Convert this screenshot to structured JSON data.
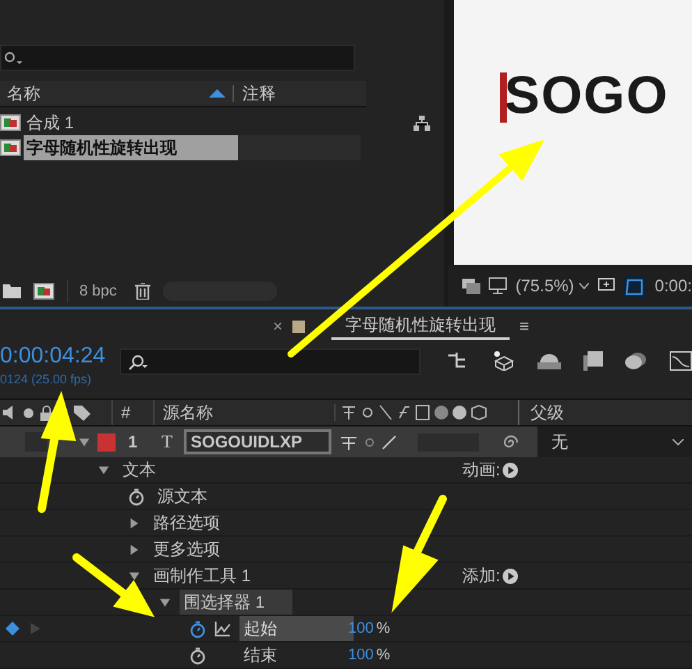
{
  "project_panel": {
    "columns": [
      "名称",
      "注释"
    ],
    "items": [
      {
        "name": "合成 1",
        "selected": false
      },
      {
        "name": "字母随机性旋转出现",
        "selected": true
      }
    ],
    "footer": {
      "bpc": "8 bpc"
    }
  },
  "viewer": {
    "preview_text": "SOGO",
    "zoom": "(75.5%)",
    "time": "0:00:"
  },
  "timeline": {
    "tab": {
      "title": "字母随机性旋转出现",
      "close": "×",
      "menu": "≡"
    },
    "timecode": "0:00:04:24",
    "frames": "0124 (25.00 fps)",
    "columns": {
      "number": "#",
      "source": "源名称",
      "parent": "父级"
    },
    "layer": {
      "index": "1",
      "type": "T",
      "name": "SOGOUIDLXP",
      "color": "#c83232",
      "parent": "无"
    },
    "properties": [
      {
        "label": "文本",
        "kind": "group",
        "expanded": true,
        "action": "动画:",
        "children": [
          {
            "label": "源文本",
            "kind": "property"
          },
          {
            "label": "路径选项",
            "kind": "group",
            "expanded": false
          },
          {
            "label": "更多选项",
            "kind": "group",
            "expanded": false
          },
          {
            "label": "画制作工具 1",
            "kind": "group",
            "expanded": true,
            "action": "添加:",
            "children": [
              {
                "label": "围选择器 1",
                "kind": "group",
                "expanded": true,
                "children": [
                  {
                    "label": "起始",
                    "kind": "property",
                    "graph": true,
                    "keyframe": true,
                    "selected": true,
                    "value": "100",
                    "unit": "%"
                  },
                  {
                    "label": "结束",
                    "kind": "property",
                    "selected": false,
                    "value": "100",
                    "unit": "%"
                  }
                ]
              }
            ]
          }
        ]
      }
    ]
  }
}
